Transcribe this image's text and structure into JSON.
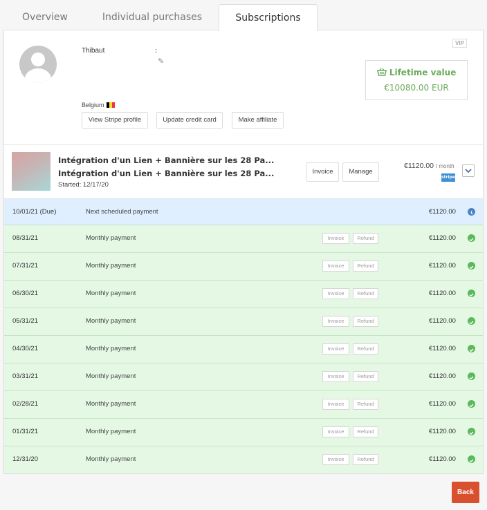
{
  "tabs": [
    "Overview",
    "Individual purchases",
    "Subscriptions"
  ],
  "customer": {
    "name": "Thibaut",
    "colon": ":",
    "badge": "VIP",
    "country": "Belgium",
    "buttons": [
      "View Stripe profile",
      "Update credit card",
      "Make affiliate"
    ]
  },
  "lifetime": {
    "title": "Lifetime value",
    "value": "€10080.00 EUR"
  },
  "subscription": {
    "title1": "Intégration d'un Lien + Bannière sur les 28 Pa...",
    "title2": "Intégration d'un Lien + Bannière sur les 28 Pa...",
    "started": "Started: 12/17/20",
    "invoice_label": "Invoice",
    "manage_label": "Manage",
    "price": "€1120.00",
    "period": "/ month",
    "processor": "stripe"
  },
  "row_buttons": {
    "invoice": "Invoice",
    "refund": "Refund"
  },
  "payments": [
    {
      "date": "10/01/21  (Due)",
      "desc": "Next scheduled payment",
      "amount": "€1120.00",
      "status": "due"
    },
    {
      "date": "08/31/21",
      "desc": "Monthly payment",
      "amount": "€1120.00",
      "status": "paid"
    },
    {
      "date": "07/31/21",
      "desc": "Monthly payment",
      "amount": "€1120.00",
      "status": "paid"
    },
    {
      "date": "06/30/21",
      "desc": "Monthly payment",
      "amount": "€1120.00",
      "status": "paid"
    },
    {
      "date": "05/31/21",
      "desc": "Monthly payment",
      "amount": "€1120.00",
      "status": "paid"
    },
    {
      "date": "04/30/21",
      "desc": "Monthly payment",
      "amount": "€1120.00",
      "status": "paid"
    },
    {
      "date": "03/31/21",
      "desc": "Monthly payment",
      "amount": "€1120.00",
      "status": "paid"
    },
    {
      "date": "02/28/21",
      "desc": "Monthly payment",
      "amount": "€1120.00",
      "status": "paid"
    },
    {
      "date": "01/31/21",
      "desc": "Monthly payment",
      "amount": "€1120.00",
      "status": "paid"
    },
    {
      "date": "12/31/20",
      "desc": "Monthly payment",
      "amount": "€1120.00",
      "status": "paid"
    }
  ],
  "back_label": "Back",
  "colors": {
    "accent_green": "#6bab5b",
    "back_button": "#d9502e",
    "due_row": "#dfefff",
    "paid_row": "#e4f8e4"
  }
}
